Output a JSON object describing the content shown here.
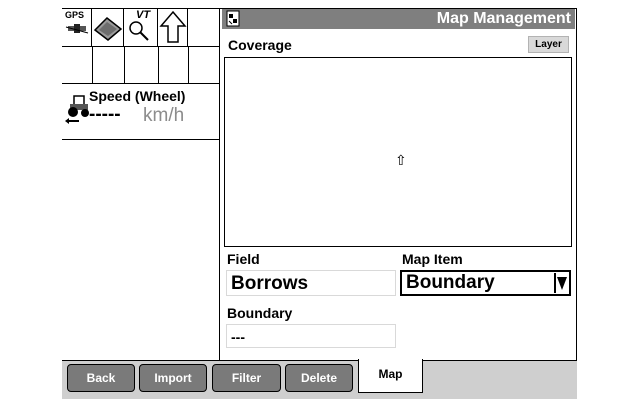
{
  "status_icons": [
    "gps-icon",
    "field-icon",
    "vt-icon",
    "arrow-up-icon"
  ],
  "gps_label": "GPS",
  "vt_label": "VT",
  "speed": {
    "title": "Speed (Wheel)",
    "value": "-----",
    "unit": "km/h"
  },
  "header": {
    "title": "Map Management"
  },
  "coverage": {
    "label": "Coverage",
    "layer_button": "Layer"
  },
  "field": {
    "label": "Field",
    "value": "Borrows"
  },
  "map_item": {
    "label": "Map Item",
    "value": "Boundary"
  },
  "boundary": {
    "label": "Boundary",
    "value": "---"
  },
  "bottom_buttons": [
    "Back",
    "Import",
    "Filter",
    "Delete"
  ],
  "active_tab": "Map"
}
